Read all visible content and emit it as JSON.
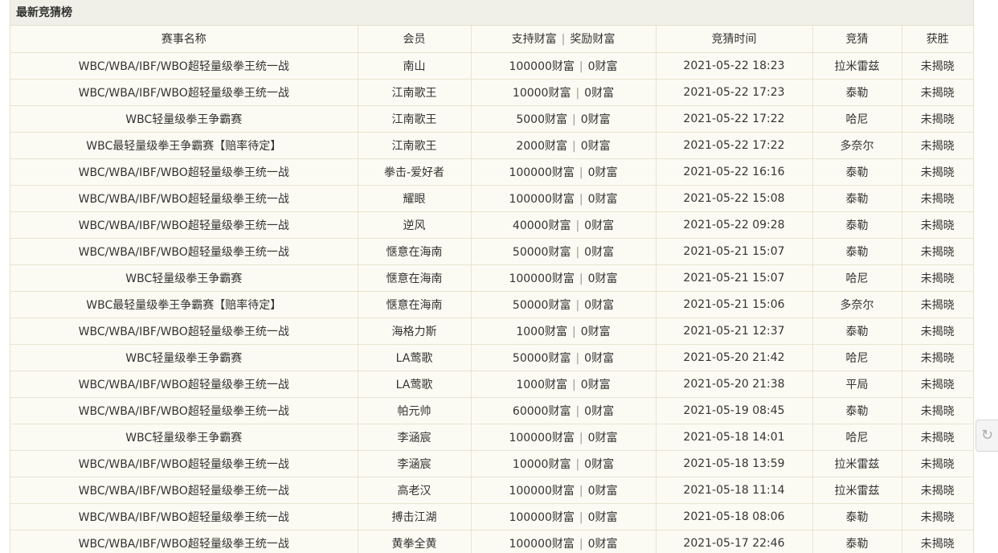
{
  "panel": {
    "title": "最新竞猜榜"
  },
  "table": {
    "headers": {
      "event": "赛事名称",
      "member": "会员",
      "support": "支持财富",
      "reward": "奖励财富",
      "time": "竞猜时间",
      "guess": "竞猜",
      "win": "获胜"
    },
    "separator": "|",
    "rows": [
      {
        "event": "WBC/WBA/IBF/WBO超轻量级拳王统一战",
        "member": "南山",
        "support": "100000财富",
        "reward": "0财富",
        "time": "2021-05-22 18:23",
        "guess": "拉米雷兹",
        "win": "未揭晓"
      },
      {
        "event": "WBC/WBA/IBF/WBO超轻量级拳王统一战",
        "member": "江南歌王",
        "support": "10000财富",
        "reward": "0财富",
        "time": "2021-05-22 17:23",
        "guess": "泰勒",
        "win": "未揭晓"
      },
      {
        "event": "WBC轻量级拳王争霸赛",
        "member": "江南歌王",
        "support": "5000财富",
        "reward": "0财富",
        "time": "2021-05-22 17:22",
        "guess": "哈尼",
        "win": "未揭晓"
      },
      {
        "event": "WBC最轻量级拳王争霸赛【赔率待定】",
        "member": "江南歌王",
        "support": "2000财富",
        "reward": "0财富",
        "time": "2021-05-22 17:22",
        "guess": "多奈尔",
        "win": "未揭晓"
      },
      {
        "event": "WBC/WBA/IBF/WBO超轻量级拳王统一战",
        "member": "拳击-爱好者",
        "support": "100000财富",
        "reward": "0财富",
        "time": "2021-05-22 16:16",
        "guess": "泰勒",
        "win": "未揭晓"
      },
      {
        "event": "WBC/WBA/IBF/WBO超轻量级拳王统一战",
        "member": "耀眼",
        "support": "100000财富",
        "reward": "0财富",
        "time": "2021-05-22 15:08",
        "guess": "泰勒",
        "win": "未揭晓"
      },
      {
        "event": "WBC/WBA/IBF/WBO超轻量级拳王统一战",
        "member": "逆风",
        "support": "40000财富",
        "reward": "0财富",
        "time": "2021-05-22 09:28",
        "guess": "泰勒",
        "win": "未揭晓"
      },
      {
        "event": "WBC/WBA/IBF/WBO超轻量级拳王统一战",
        "member": "惬意在海南",
        "support": "50000财富",
        "reward": "0财富",
        "time": "2021-05-21 15:07",
        "guess": "泰勒",
        "win": "未揭晓"
      },
      {
        "event": "WBC轻量级拳王争霸赛",
        "member": "惬意在海南",
        "support": "100000财富",
        "reward": "0财富",
        "time": "2021-05-21 15:07",
        "guess": "哈尼",
        "win": "未揭晓"
      },
      {
        "event": "WBC最轻量级拳王争霸赛【赔率待定】",
        "member": "惬意在海南",
        "support": "50000财富",
        "reward": "0财富",
        "time": "2021-05-21 15:06",
        "guess": "多奈尔",
        "win": "未揭晓"
      },
      {
        "event": "WBC/WBA/IBF/WBO超轻量级拳王统一战",
        "member": "海格力斯",
        "support": "1000财富",
        "reward": "0财富",
        "time": "2021-05-21 12:37",
        "guess": "泰勒",
        "win": "未揭晓"
      },
      {
        "event": "WBC轻量级拳王争霸赛",
        "member": "LA莺歌",
        "support": "50000财富",
        "reward": "0财富",
        "time": "2021-05-20 21:42",
        "guess": "哈尼",
        "win": "未揭晓"
      },
      {
        "event": "WBC/WBA/IBF/WBO超轻量级拳王统一战",
        "member": "LA莺歌",
        "support": "1000财富",
        "reward": "0财富",
        "time": "2021-05-20 21:38",
        "guess": "平局",
        "win": "未揭晓"
      },
      {
        "event": "WBC/WBA/IBF/WBO超轻量级拳王统一战",
        "member": "帕元帅",
        "support": "60000财富",
        "reward": "0财富",
        "time": "2021-05-19 08:45",
        "guess": "泰勒",
        "win": "未揭晓"
      },
      {
        "event": "WBC轻量级拳王争霸赛",
        "member": "李涵宸",
        "support": "100000财富",
        "reward": "0财富",
        "time": "2021-05-18 14:01",
        "guess": "哈尼",
        "win": "未揭晓"
      },
      {
        "event": "WBC/WBA/IBF/WBO超轻量级拳王统一战",
        "member": "李涵宸",
        "support": "10000财富",
        "reward": "0财富",
        "time": "2021-05-18 13:59",
        "guess": "拉米雷兹",
        "win": "未揭晓"
      },
      {
        "event": "WBC/WBA/IBF/WBO超轻量级拳王统一战",
        "member": "高老汉",
        "support": "100000财富",
        "reward": "0财富",
        "time": "2021-05-18 11:14",
        "guess": "拉米雷兹",
        "win": "未揭晓"
      },
      {
        "event": "WBC/WBA/IBF/WBO超轻量级拳王统一战",
        "member": "搏击江湖",
        "support": "100000财富",
        "reward": "0财富",
        "time": "2021-05-18 08:06",
        "guess": "泰勒",
        "win": "未揭晓"
      },
      {
        "event": "WBC/WBA/IBF/WBO超轻量级拳王统一战",
        "member": "黄拳全黄",
        "support": "100000财富",
        "reward": "0财富",
        "time": "2021-05-17 22:46",
        "guess": "泰勒",
        "win": "未揭晓"
      }
    ]
  },
  "side_button": {
    "icon": "refresh-icon",
    "glyph": "↻"
  }
}
